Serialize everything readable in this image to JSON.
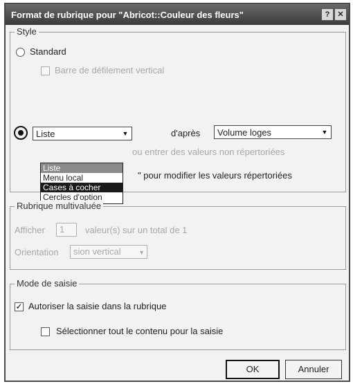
{
  "dialog": {
    "title": "Format de rubrique pour \"Abricot::Couleur des fleurs\"",
    "help_label": "?",
    "close_label": "✕"
  },
  "style": {
    "legend": "Style",
    "standard_label": "Standard",
    "vertical_scrollbar_label": "Barre de défilement vertical",
    "list_select_value": "Liste",
    "based_on_label": "d'après",
    "based_on_value": "Volume loges",
    "include_other_label": "ou entrer des valeurs non répertoriées",
    "edit_values_label": "\" pour modifier les valeurs répertoriées",
    "dropdown_options": [
      "Liste",
      "Menu local",
      "Cases à cocher",
      "Cercles d'option"
    ],
    "dropdown_selected_index": 2
  },
  "multivalue": {
    "legend": "Rubrique multivaluée",
    "show_label": "Afficher",
    "show_value": "1",
    "values_of_total_label": "valeur(s) sur un total de 1",
    "orientation_label": "Orientation",
    "orientation_value": "sion vertical"
  },
  "input_mode": {
    "legend": "Mode de saisie",
    "allow_entry_label": "Autoriser la saisie dans la rubrique",
    "allow_entry_checked": true,
    "select_all_label": "Sélectionner tout le contenu pour la saisie",
    "select_all_checked": false
  },
  "buttons": {
    "ok_label": "OK",
    "cancel_label": "Annuler"
  },
  "icons": {
    "dropdown_arrow": "▼",
    "checkmark": "✓"
  }
}
